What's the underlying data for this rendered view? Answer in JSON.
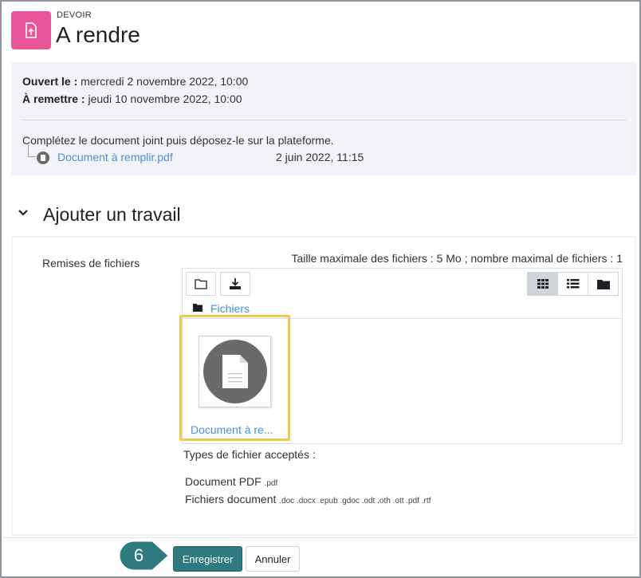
{
  "header": {
    "module_type": "DEVOIR",
    "title": "A rendre",
    "icon": "assignment-upload-icon",
    "icon_color": "#e8559b"
  },
  "dates": {
    "opened_label": "Ouvert le :",
    "opened_value": "mercredi 2 novembre 2022, 10:00",
    "due_label": "À remettre :",
    "due_value": "jeudi 10 novembre 2022, 10:00"
  },
  "intro": {
    "text": "Complétez le document joint puis déposez-le sur la plateforme.",
    "attachment_name": "Document à remplir.pdf",
    "attachment_date": "2 juin 2022, 11:15"
  },
  "section": {
    "title": "Ajouter un travail"
  },
  "submission": {
    "field_label": "Remises de fichiers",
    "limits": "Taille maximale des fichiers : 5 Mo ; nombre maximal de fichiers : 1",
    "breadcrumb": "Fichiers",
    "file_name": "Document à re...",
    "accepted_title": "Types de fichier acceptés :",
    "accepted_types": [
      {
        "name": "Document PDF",
        "ext": ".pdf"
      },
      {
        "name": "Fichiers document",
        "ext": ".doc .docx .epub .gdoc .odt .oth .ott .pdf .rtf"
      }
    ]
  },
  "buttons": {
    "save": "Enregistrer",
    "cancel": "Annuler"
  },
  "annotation": {
    "step": "6",
    "badge_color": "#2f7a80",
    "highlight_color": "#f2c94c"
  }
}
